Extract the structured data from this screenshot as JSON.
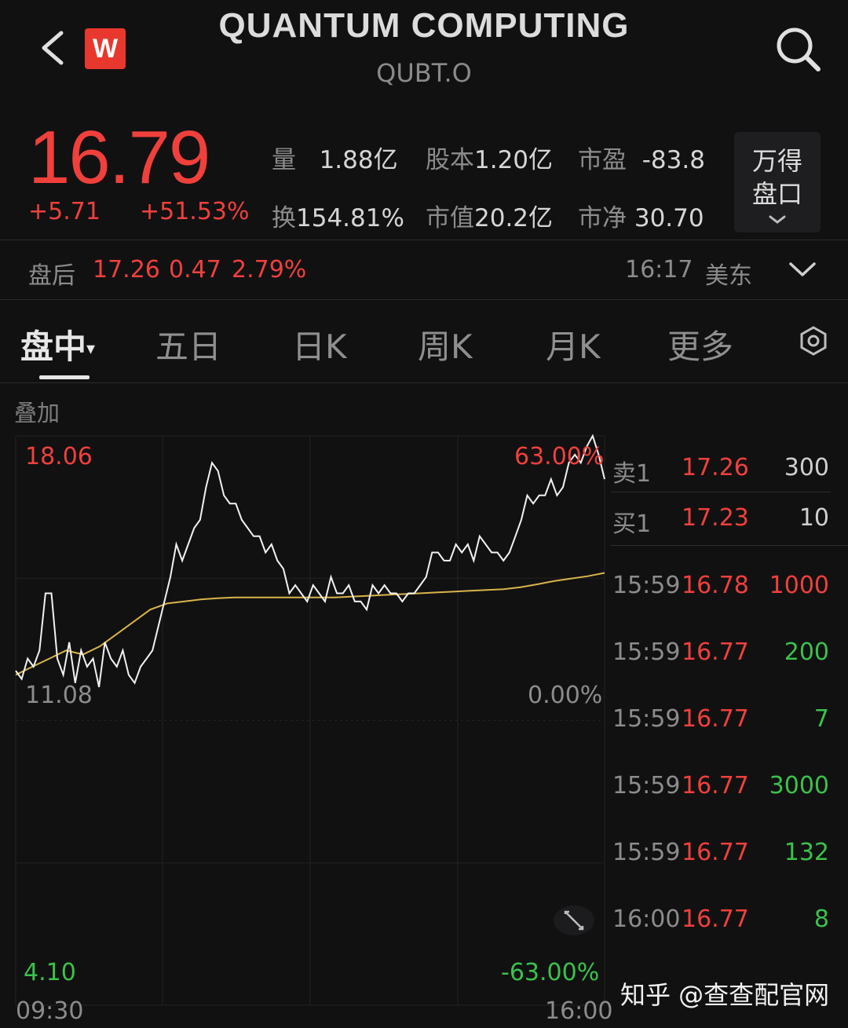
{
  "header": {
    "title": "QUANTUM COMPUTING",
    "ticker": "QUBT.O",
    "logo_letter": "W"
  },
  "quote": {
    "price": "16.79",
    "change": "+5.71",
    "change_pct": "+51.53%",
    "stats": {
      "volume_label": "量",
      "volume": "1.88亿",
      "share_cap_label": "股本",
      "share_cap": "1.20亿",
      "pe_label": "市盈",
      "pe": "-83.8",
      "turnover_label": "换",
      "turnover": "154.81%",
      "mkt_cap_label": "市值",
      "mkt_cap": "20.2亿",
      "pb_label": "市净",
      "pb": "30.70"
    },
    "wande_button": "万得盘口"
  },
  "after_hours": {
    "label": "盘后",
    "price": "17.26",
    "change": "0.47",
    "change_pct": "2.79%",
    "time": "16:17",
    "zone": "美东"
  },
  "tabs": [
    "盘中",
    "五日",
    "日K",
    "周K",
    "月K",
    "更多"
  ],
  "overlay_label": "叠加",
  "chart_labels": {
    "high": "18.06",
    "high_pct": "63.00%",
    "mid": "11.08",
    "mid_pct": "0.00%",
    "low": "4.10",
    "low_pct": "-63.00%",
    "start_time": "09:30",
    "end_time": "16:00"
  },
  "order_book": {
    "ask_label": "卖1",
    "ask_price": "17.26",
    "ask_size": "300",
    "bid_label": "买1",
    "bid_price": "17.23",
    "bid_size": "10"
  },
  "trades": [
    {
      "time": "15:59",
      "price": "16.78",
      "size": "1000",
      "dir": "sell"
    },
    {
      "time": "15:59",
      "price": "16.77",
      "size": "200",
      "dir": "buy"
    },
    {
      "time": "15:59",
      "price": "16.77",
      "size": "7",
      "dir": "buy"
    },
    {
      "time": "15:59",
      "price": "16.77",
      "size": "3000",
      "dir": "buy"
    },
    {
      "time": "15:59",
      "price": "16.77",
      "size": "132",
      "dir": "buy"
    },
    {
      "time": "16:00",
      "price": "16.77",
      "size": "8",
      "dir": "buy"
    }
  ],
  "watermark": "知乎 @查查配官网",
  "colors": {
    "background": "#111112",
    "up": "#f0403c",
    "down": "#3bc24a",
    "price_line": "#f2f2f2",
    "avg_line": "#d9b44a"
  },
  "chart_data": {
    "type": "line",
    "title": "",
    "ylim": [
      4.1,
      18.06
    ],
    "y_reference": 11.08,
    "x_range": [
      "09:30",
      "16:00"
    ],
    "series": [
      {
        "values": [
          12.3,
          12.1,
          12.6,
          12.4,
          12.8,
          14.2,
          14.2,
          12.6,
          12.2,
          13.0,
          12.0,
          12.8,
          12.4,
          12.6,
          11.9,
          13.0,
          12.6,
          12.4,
          12.8,
          12.2,
          12.0,
          12.4,
          12.6,
          12.8,
          13.4,
          14.0,
          14.6,
          15.4,
          15.0,
          15.4,
          15.8,
          16.0,
          16.8,
          17.4,
          17.2,
          16.6,
          16.4,
          16.4,
          16.0,
          15.8,
          15.6,
          15.6,
          15.2,
          15.4,
          15.0,
          14.8,
          14.2,
          14.4,
          14.2,
          14.0,
          14.4,
          14.2,
          14.0,
          14.6,
          14.2,
          14.2,
          14.4,
          14.0,
          14.0,
          13.8,
          14.4,
          14.2,
          14.4,
          14.2,
          14.2,
          14.0,
          14.2,
          14.2,
          14.4,
          14.6,
          15.2,
          15.2,
          15.0,
          15.0,
          15.4,
          15.2,
          15.4,
          15.0,
          15.6,
          15.4,
          15.2,
          15.2,
          15.0,
          15.2,
          15.6,
          16.0,
          16.6,
          16.4,
          16.6,
          16.6,
          17.0,
          16.6,
          16.8,
          17.4,
          17.6,
          17.4,
          17.8,
          18.06,
          17.6,
          17.0
        ],
        "note": ""
      },
      {
        "values": [
          12.2,
          12.4,
          12.6,
          12.8,
          12.7,
          12.9,
          13.2,
          13.5,
          13.8,
          13.95,
          14.0,
          14.05,
          14.08,
          14.1,
          14.1,
          14.1,
          14.1,
          14.1,
          14.1,
          14.1,
          14.12,
          14.14,
          14.16,
          14.18,
          14.2,
          14.22,
          14.24,
          14.26,
          14.28,
          14.3,
          14.35,
          14.42,
          14.5,
          14.56,
          14.62,
          14.7
        ]
      }
    ]
  }
}
